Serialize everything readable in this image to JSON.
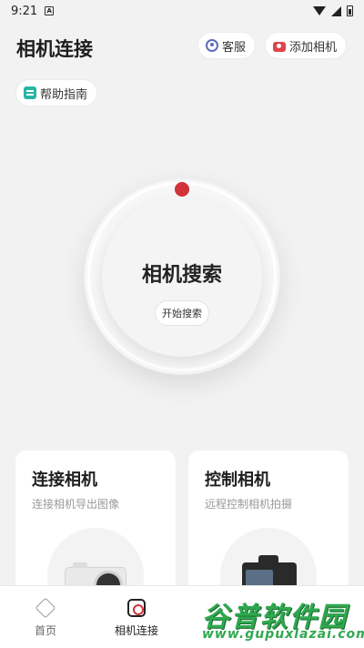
{
  "status_bar": {
    "time": "9:21",
    "notification_letter": "A"
  },
  "header": {
    "title": "相机连接",
    "service_label": "客服",
    "add_camera_label": "添加相机",
    "help_label": "帮助指南"
  },
  "dial": {
    "title": "相机搜索",
    "button_label": "开始搜索",
    "accent": "#d2323a"
  },
  "cards": [
    {
      "title": "连接相机",
      "subtitle": "连接相机导出图像"
    },
    {
      "title": "控制相机",
      "subtitle": "远程控制相机拍摄"
    }
  ],
  "tabbar": {
    "tabs": [
      {
        "label": "首页",
        "icon": "home-icon"
      },
      {
        "label": "相机连接",
        "icon": "camera-icon",
        "active": true
      }
    ]
  },
  "watermark": {
    "text": "谷普软件园",
    "url": "www.gupuxlazai.com"
  },
  "colors": {
    "background": "#f2f2f2",
    "accent": "#d2323a",
    "watermark": "#2fa84f"
  }
}
